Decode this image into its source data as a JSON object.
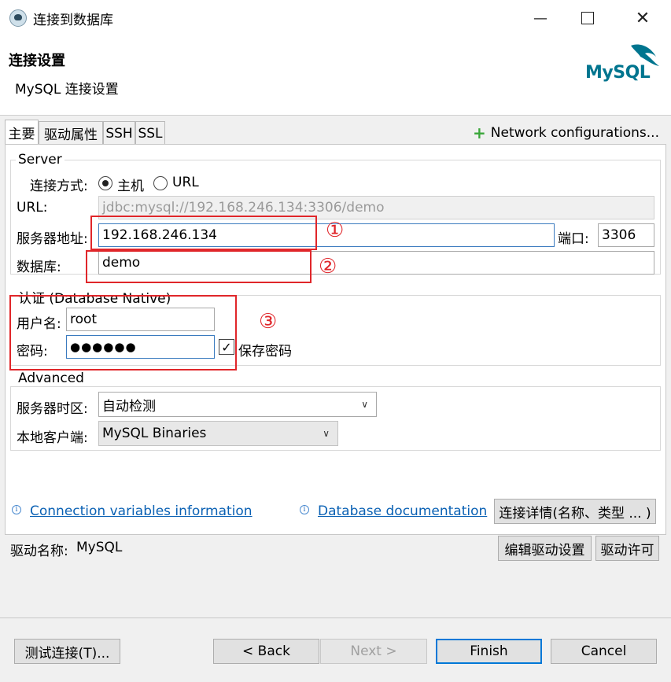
{
  "window": {
    "title": "连接到数据库"
  },
  "header": {
    "title": "连接设置",
    "subtitle": "MySQL 连接设置",
    "logo_text": "MySQL"
  },
  "tabs": [
    {
      "label": "主要",
      "active": true
    },
    {
      "label": "驱动属性"
    },
    {
      "label": "SSH"
    },
    {
      "label": "SSL"
    }
  ],
  "network_config": {
    "plus": "+",
    "label": "Network configurations..."
  },
  "server": {
    "legend": "Server",
    "connect_mode_label": "连接方式:",
    "mode_host": "主机",
    "mode_url": "URL",
    "url_label": "URL:",
    "url_value": "jdbc:mysql://192.168.246.134:3306/demo",
    "host_label": "服务器地址:",
    "host_value": "192.168.246.134",
    "port_label": "端口:",
    "port_value": "3306",
    "db_label": "数据库:",
    "db_value": "demo"
  },
  "auth": {
    "legend": "认证 (Database Native)",
    "user_label": "用户名:",
    "user_value": "root",
    "pass_label": "密码:",
    "pass_value": "●●●●●●",
    "save_password_label": "保存密码",
    "save_password_checked": true
  },
  "annotations": {
    "one": "①",
    "two": "②",
    "three": "③"
  },
  "advanced": {
    "legend": "Advanced",
    "tz_label": "服务器时区:",
    "tz_value": "自动检测",
    "client_label": "本地客户端:",
    "client_value": "MySQL Binaries"
  },
  "links": {
    "conn_vars": "Connection variables information",
    "db_docs": "Database documentation",
    "conn_details_button": "连接详情(名称、类型 ... )"
  },
  "driver": {
    "name_label": "驱动名称:",
    "name_value": "MySQL",
    "edit_button": "编辑驱动设置",
    "license_button": "驱动许可"
  },
  "footer": {
    "test_button": "测试连接(T)...",
    "back_button": "< Back",
    "next_button": "Next >",
    "finish_button": "Finish",
    "cancel_button": "Cancel"
  },
  "colors": {
    "annotation_red": "#e0262a",
    "link_blue": "#0a61b4",
    "mysql_teal": "#00758f",
    "mysql_orange": "#f29111"
  },
  "icons": [
    "app-icon",
    "minimize-icon",
    "maximize-icon",
    "close-icon",
    "plus-icon",
    "info-icon",
    "chevron-down-icon",
    "checkmark-icon",
    "mysql-dolphin-icon"
  ]
}
